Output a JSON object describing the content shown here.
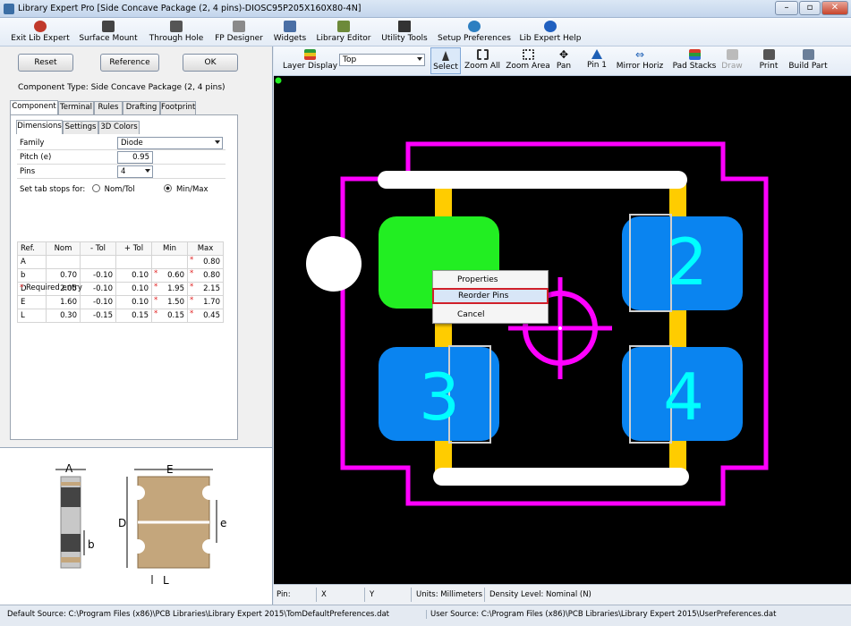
{
  "window": {
    "title": "Library Expert Pro [Side Concave Package (2, 4 pins)-DIOSC95P205X160X80-4N]",
    "controls": [
      "–",
      "▫",
      "✕"
    ]
  },
  "menubar": [
    {
      "label": "Exit Lib Expert",
      "icon": "exit-icon",
      "color": "#c0392b"
    },
    {
      "label": "Surface Mount",
      "icon": "smd-chip-icon",
      "color": "#444444"
    },
    {
      "label": "Through Hole",
      "icon": "through-hole-icon",
      "color": "#444444"
    },
    {
      "label": "FP Designer",
      "icon": "fp-designer-icon",
      "color": "#7a7a7a"
    },
    {
      "label": "Widgets",
      "icon": "widgets-icon",
      "color": "#4a6fa5"
    },
    {
      "label": "Library Editor",
      "icon": "library-editor-icon",
      "color": "#6d8a3a"
    },
    {
      "label": "Utility Tools",
      "icon": "calculator-icon",
      "color": "#333333"
    },
    {
      "label": "Setup Preferences",
      "icon": "globe-gear-icon",
      "color": "#2d7fc1"
    },
    {
      "label": "Lib Expert Help",
      "icon": "help-icon",
      "color": "#2060c0"
    }
  ],
  "left": {
    "buttons": {
      "reset": "Reset",
      "reference": "Reference",
      "ok": "OK"
    },
    "component_type": "Component Type: Side Concave Package (2, 4 pins)",
    "tabs": [
      "Component",
      "Terminal",
      "Rules",
      "Drafting",
      "Footprint"
    ],
    "subtabs": [
      "Dimensions",
      "Settings",
      "3D Colors"
    ],
    "family": {
      "label": "Family",
      "value": "Diode"
    },
    "pitch": {
      "label": "Pitch (e)",
      "value": "0.95"
    },
    "pins": {
      "label": "Pins",
      "value": "4"
    },
    "tabstops": {
      "label": "Set tab stops for:",
      "opt1": "Nom/Tol",
      "opt2": "Min/Max",
      "selected": "Min/Max"
    },
    "table": {
      "headers": [
        "Ref.",
        "Nom",
        "- Tol",
        "+ Tol",
        "Min",
        "Max"
      ],
      "rows": [
        {
          "ref": "A",
          "nom": "",
          "mtol": "",
          "ptol": "",
          "min": "",
          "max": "0.80",
          "reqmax": true,
          "reqmin": false
        },
        {
          "ref": "b",
          "nom": "0.70",
          "mtol": "-0.10",
          "ptol": "0.10",
          "min": "0.60",
          "max": "0.80",
          "reqmax": true,
          "reqmin": true
        },
        {
          "ref": "D",
          "nom": "2.05",
          "mtol": "-0.10",
          "ptol": "0.10",
          "min": "1.95",
          "max": "2.15",
          "reqmax": true,
          "reqmin": true
        },
        {
          "ref": "E",
          "nom": "1.60",
          "mtol": "-0.10",
          "ptol": "0.10",
          "min": "1.50",
          "max": "1.70",
          "reqmax": true,
          "reqmin": true
        },
        {
          "ref": "L",
          "nom": "0.30",
          "mtol": "-0.15",
          "ptol": "0.15",
          "min": "0.15",
          "max": "0.45",
          "reqmax": true,
          "reqmin": true
        }
      ]
    },
    "required": "Required entry",
    "required_mark": "*",
    "diagram_labels": {
      "A": "A",
      "E": "E",
      "D": "D",
      "e": "e",
      "b": "b",
      "L": "L"
    }
  },
  "toolbar": {
    "layer_display": "Layer Display",
    "layer_select": "Top",
    "buttons": [
      {
        "label": "Select",
        "icon": "cursor-icon"
      },
      {
        "label": "Zoom All",
        "icon": "zoom-all-icon"
      },
      {
        "label": "Zoom Area",
        "icon": "zoom-area-icon"
      },
      {
        "label": "Pan",
        "icon": "pan-icon"
      },
      {
        "label": "Pin 1",
        "icon": "pin1-icon"
      },
      {
        "label": "Mirror Horiz",
        "icon": "mirror-horiz-icon"
      },
      {
        "label": "Pad Stacks",
        "icon": "pad-stacks-icon"
      },
      {
        "label": "Draw",
        "icon": "draw-icon"
      },
      {
        "label": "Print",
        "icon": "printer-icon"
      },
      {
        "label": "Build Part",
        "icon": "build-part-icon"
      }
    ]
  },
  "canvas": {
    "pads": [
      "2",
      "3",
      "4"
    ],
    "colors": {
      "silk": "#ff00ff",
      "pad": "#0a84f0",
      "pin1": "#22ee22",
      "courtyard": "#ffffff",
      "body": "#ffcc00",
      "text": "#00ffff"
    }
  },
  "context_menu": [
    "Properties",
    "Reorder Pins",
    "Cancel"
  ],
  "status": {
    "pin": "Pin:",
    "x": "X",
    "y": "Y",
    "units": "Units: Millimeters",
    "density": "Density Level: Nominal (N)"
  },
  "footer": {
    "default_source": "Default Source:  C:\\Program Files (x86)\\PCB Libraries\\Library Expert 2015\\TomDefaultPreferences.dat",
    "user_source": "User Source:  C:\\Program Files (x86)\\PCB Libraries\\Library Expert 2015\\UserPreferences.dat"
  }
}
